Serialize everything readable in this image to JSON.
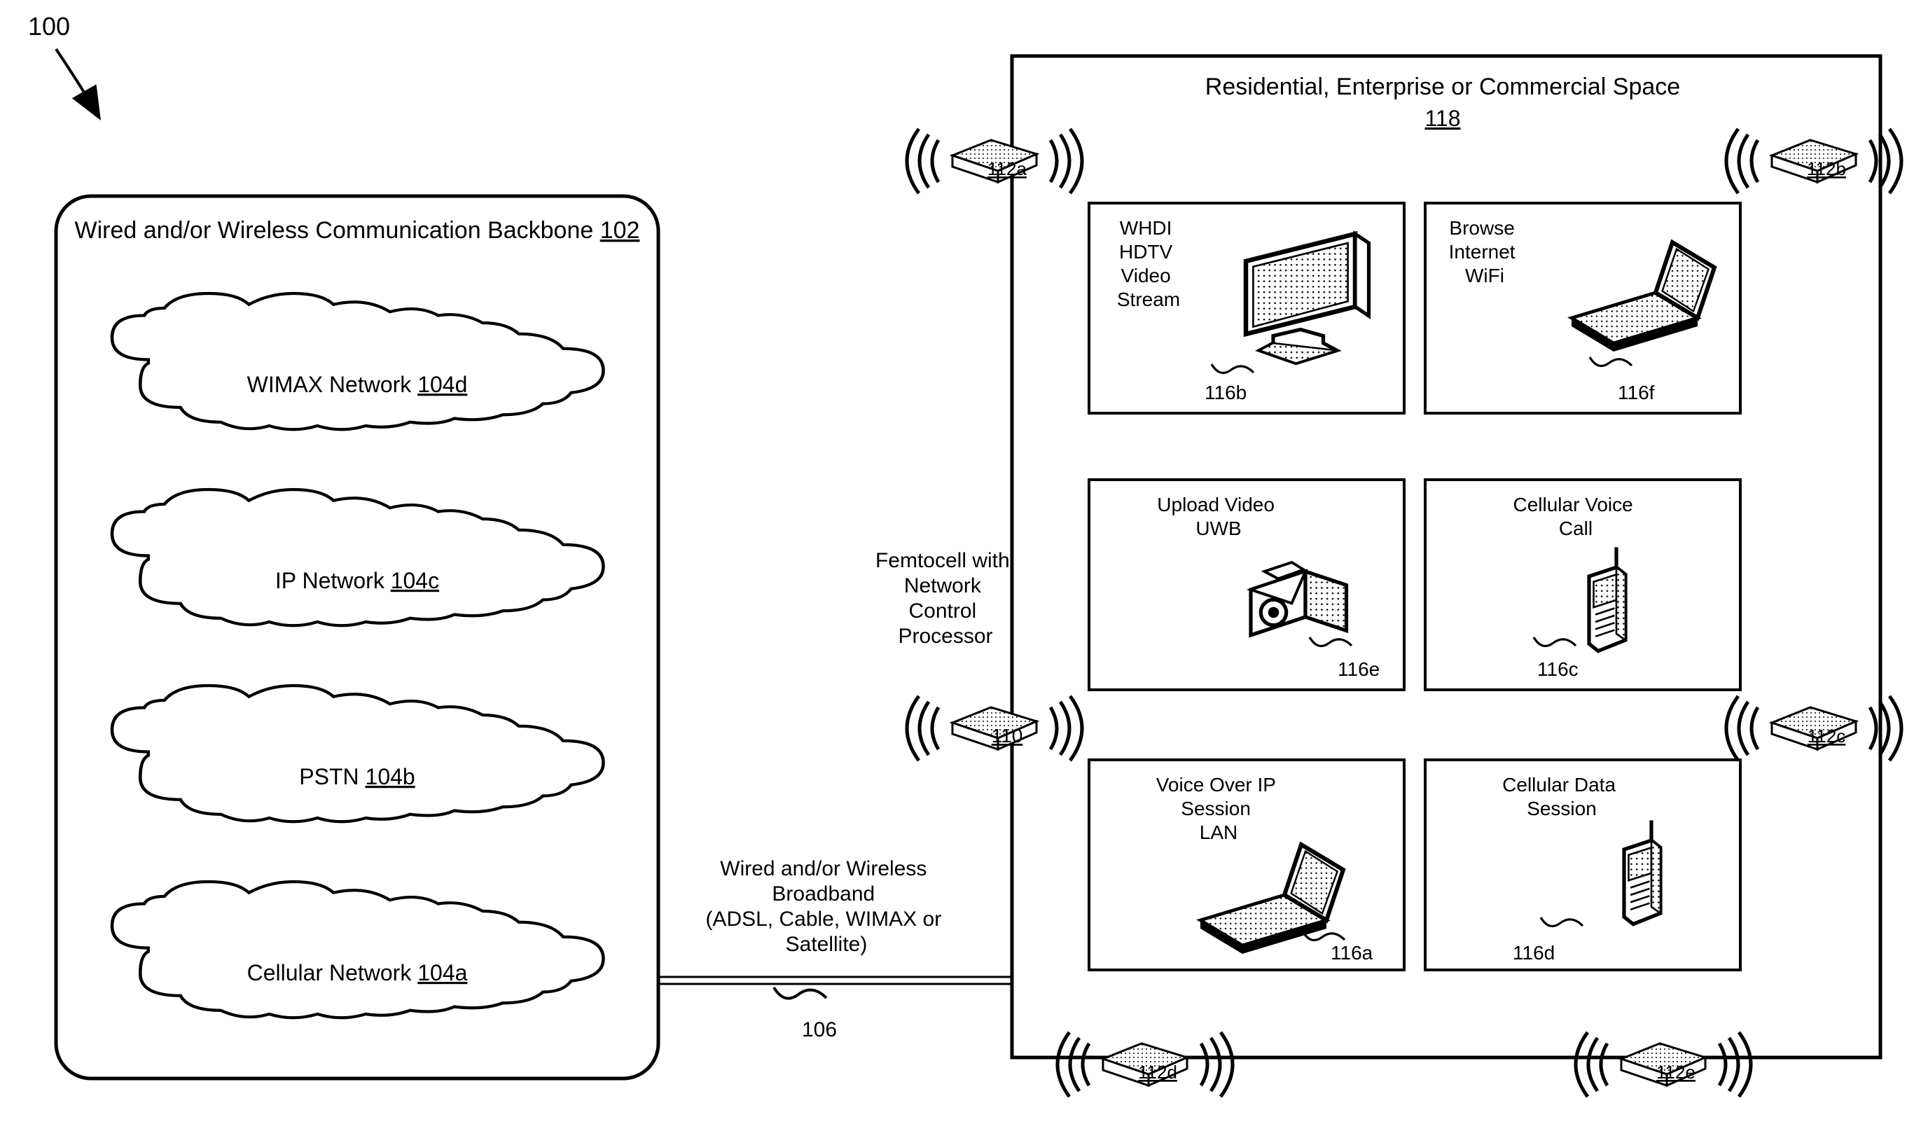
{
  "figureRef": "100",
  "backbone": {
    "title": "Wired and/or Wireless Communication Backbone",
    "ref": "102",
    "clouds": [
      {
        "label": "WIMAX Network",
        "ref": "104d"
      },
      {
        "label": "IP Network",
        "ref": "104c"
      },
      {
        "label": "PSTN",
        "ref": "104b"
      },
      {
        "label": "Cellular Network",
        "ref": "104a"
      }
    ]
  },
  "link": {
    "label_l1": "Wired and/or Wireless",
    "label_l2": "Broadband",
    "label_l3": "(ADSL, Cable, WIMAX or",
    "label_l4": "Satellite)",
    "ref": "106"
  },
  "femto": {
    "label_l1": "Femtocell with",
    "label_l2": "Network",
    "label_l3": "Control",
    "label_l4": "Processor",
    "ref": "110"
  },
  "space": {
    "title": "Residential, Enterprise or Commercial Space",
    "ref": "118"
  },
  "aps": [
    {
      "ref": "112a"
    },
    {
      "ref": "112b"
    },
    {
      "ref": "112c"
    },
    {
      "ref": "112d"
    },
    {
      "ref": "112e"
    }
  ],
  "devices": {
    "r1c1": {
      "l1": "WHDI",
      "l2": "HDTV",
      "l3": "Video",
      "l4": "Stream",
      "ref": "116b"
    },
    "r1c2": {
      "l1": "Browse",
      "l2": "Internet",
      "l3": "WiFi",
      "ref": "116f"
    },
    "r2c1": {
      "l1": "Upload Video",
      "l2": "UWB",
      "ref": "116e"
    },
    "r2c2": {
      "l1": "Cellular Voice",
      "l2": "Call",
      "ref": "116c"
    },
    "r3c1": {
      "l1": "Voice Over IP",
      "l2": "Session",
      "l3": "LAN",
      "ref": "116a"
    },
    "r3c2": {
      "l1": "Cellular Data",
      "l2": "Session",
      "ref": "116d"
    }
  }
}
